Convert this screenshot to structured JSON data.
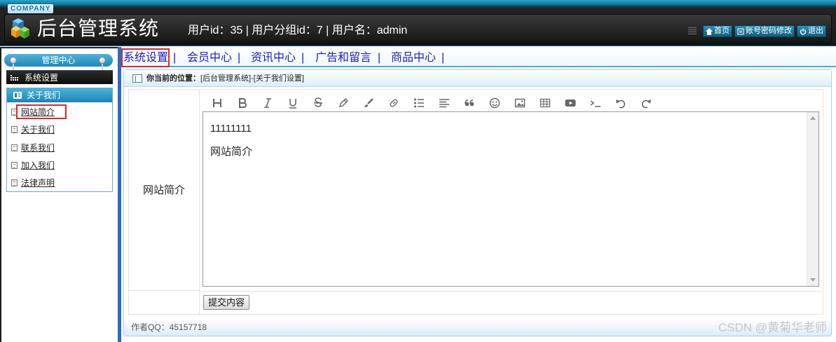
{
  "header": {
    "company_badge": "COMPANY",
    "app_title": "后台管理系统",
    "user_info": "用户id：35 | 用户分组id：7 | 用户名：admin",
    "buttons": [
      {
        "label": "首页",
        "icon": "home-icon"
      },
      {
        "label": "账号密码修改",
        "icon": "list-icon"
      },
      {
        "label": "退出",
        "icon": "power-icon"
      }
    ]
  },
  "sidebar": {
    "title": "管理中心",
    "section": "系统设置",
    "group": "关于我们",
    "items": [
      {
        "label": "网站简介",
        "selected": true
      },
      {
        "label": "关于我们"
      },
      {
        "label": "联系我们"
      },
      {
        "label": "加入我们"
      },
      {
        "label": "法律声明"
      }
    ]
  },
  "topnav": {
    "items": [
      "系统设置",
      "会员中心",
      "资讯中心",
      "广告和留言",
      "商品中心"
    ],
    "separator": "|",
    "active": "系统设置"
  },
  "breadcrumb": {
    "label": "你当前的位置：",
    "path": "[后台管理系统]-[关于我们设置]"
  },
  "form": {
    "field_label": "网站简介",
    "toolbar_icons": [
      "heading-icon",
      "bold-icon",
      "italic-icon",
      "underline-icon",
      "strikethrough-icon",
      "pencil-icon",
      "brush-icon",
      "link-icon",
      "bullet-list-icon",
      "align-icon",
      "quote-icon",
      "emoji-icon",
      "image-icon",
      "table-icon",
      "video-icon",
      "code-icon",
      "undo-icon",
      "redo-icon"
    ],
    "editor_paragraphs": [
      "11111111",
      "网站简介"
    ],
    "submit_label": "提交内容"
  },
  "footer": {
    "author": "作者QQ：45157718"
  },
  "watermark": "CSDN @黄菊华老师",
  "colors": {
    "accent": "#1f88b6",
    "nav_link": "#1b1bbf",
    "highlight": "#e0262b",
    "header_dark": "#161616"
  }
}
